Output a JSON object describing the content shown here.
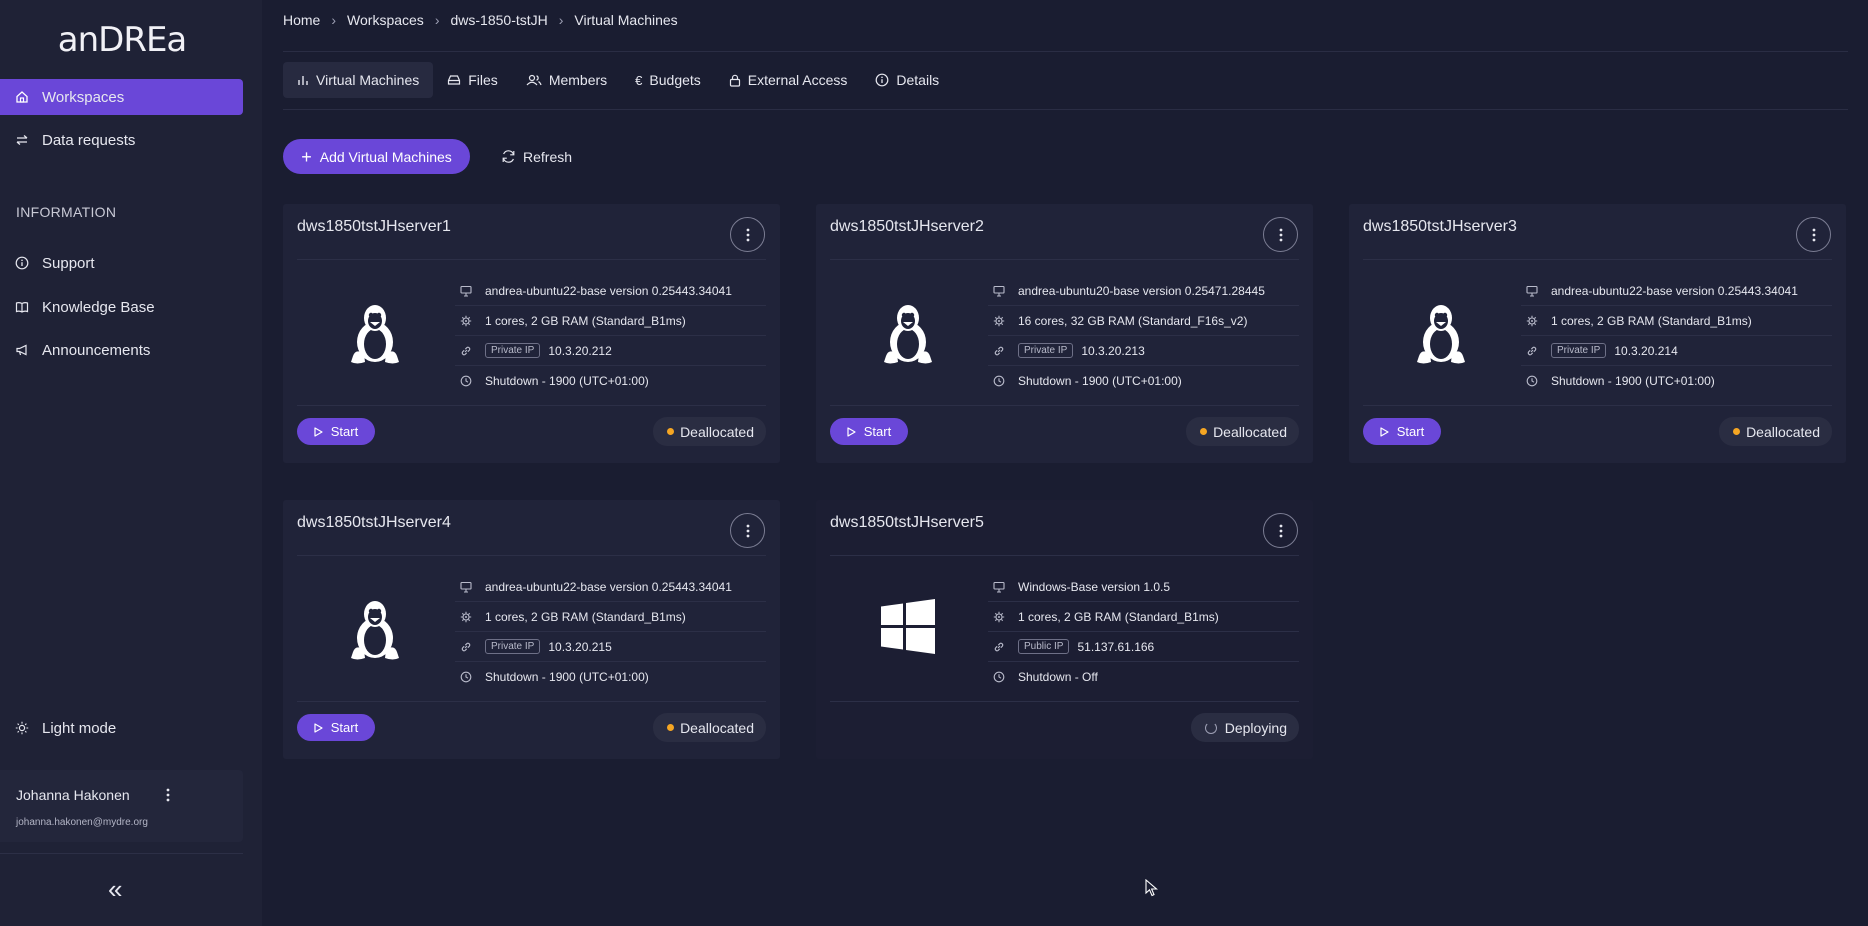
{
  "app": {
    "logo_text": "anDREa"
  },
  "sidebar": {
    "items": [
      {
        "label": "Workspaces",
        "icon": "home-icon",
        "active": true
      },
      {
        "label": "Data requests",
        "icon": "transfer-icon",
        "active": false
      }
    ],
    "section_label": "INFORMATION",
    "info_items": [
      {
        "label": "Support",
        "icon": "info-icon"
      },
      {
        "label": "Knowledge Base",
        "icon": "book-icon"
      },
      {
        "label": "Announcements",
        "icon": "megaphone-icon"
      }
    ],
    "light_mode_label": "Light mode",
    "user": {
      "name": "Johanna Hakonen",
      "email": "johanna.hakonen@mydre.org"
    },
    "collapse_glyph": "«"
  },
  "breadcrumb": [
    "Home",
    "Workspaces",
    "dws-1850-tstJH",
    "Virtual Machines"
  ],
  "tabs": [
    {
      "label": "Virtual Machines",
      "icon": "chart-icon",
      "active": true
    },
    {
      "label": "Files",
      "icon": "drive-icon",
      "active": false
    },
    {
      "label": "Members",
      "icon": "users-icon",
      "active": false
    },
    {
      "label": "Budgets",
      "icon": "euro-icon",
      "active": false
    },
    {
      "label": "External Access",
      "icon": "lock-icon",
      "active": false
    },
    {
      "label": "Details",
      "icon": "info-icon",
      "active": false
    }
  ],
  "toolbar": {
    "add_label": "Add Virtual Machines",
    "refresh_label": "Refresh"
  },
  "status_colors": {
    "deallocated": "#f5a623",
    "accent": "#6a47d8"
  },
  "vms": [
    {
      "name": "dws1850tstJHserver1",
      "os": "linux",
      "image": "andrea-ubuntu22-base version 0.25443.34041",
      "size": "1 cores, 2 GB RAM (Standard_B1ms)",
      "ip_type": "Private IP",
      "ip": "10.3.20.212",
      "shutdown": "Shutdown -  1900  (UTC+01:00)",
      "start_label": "Start",
      "status": "Deallocated"
    },
    {
      "name": "dws1850tstJHserver2",
      "os": "linux",
      "image": "andrea-ubuntu20-base version 0.25471.28445",
      "size": "16 cores, 32 GB RAM (Standard_F16s_v2)",
      "ip_type": "Private IP",
      "ip": "10.3.20.213",
      "shutdown": "Shutdown -  1900  (UTC+01:00)",
      "start_label": "Start",
      "status": "Deallocated"
    },
    {
      "name": "dws1850tstJHserver3",
      "os": "linux",
      "image": "andrea-ubuntu22-base version 0.25443.34041",
      "size": "1 cores, 2 GB RAM (Standard_B1ms)",
      "ip_type": "Private IP",
      "ip": "10.3.20.214",
      "shutdown": "Shutdown -  1900  (UTC+01:00)",
      "start_label": "Start",
      "status": "Deallocated"
    },
    {
      "name": "dws1850tstJHserver4",
      "os": "linux",
      "image": "andrea-ubuntu22-base version 0.25443.34041",
      "size": "1 cores, 2 GB RAM (Standard_B1ms)",
      "ip_type": "Private IP",
      "ip": "10.3.20.215",
      "shutdown": "Shutdown -  1900  (UTC+01:00)",
      "start_label": "Start",
      "status": "Deallocated"
    },
    {
      "name": "dws1850tstJHserver5",
      "os": "windows",
      "image": "Windows-Base version 1.0.5",
      "size": "1 cores, 2 GB RAM (Standard_B1ms)",
      "ip_type": "Public IP",
      "ip": "51.137.61.166",
      "shutdown": "Shutdown -  Off",
      "start_label": "",
      "status": "Deploying"
    }
  ]
}
